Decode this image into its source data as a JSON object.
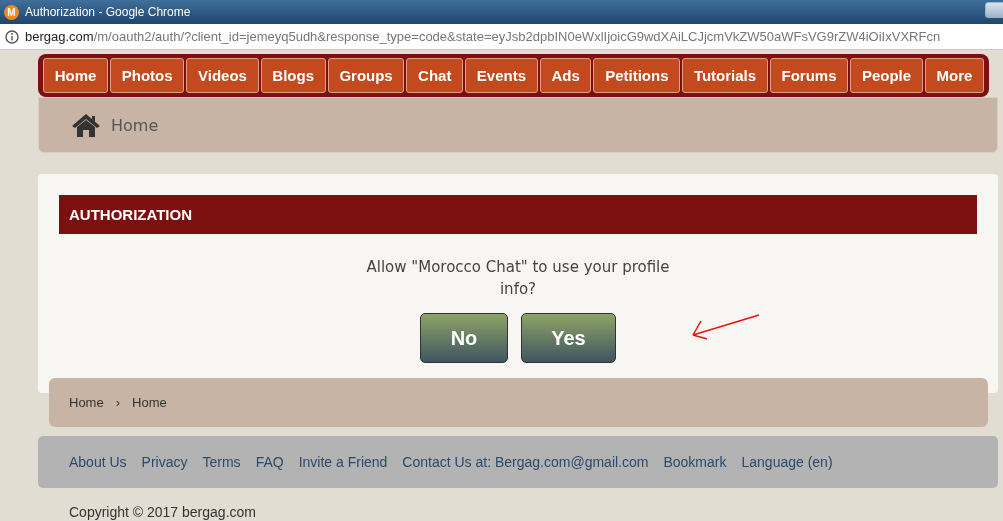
{
  "window": {
    "logo_letter": "M",
    "title": "Authorization - Google Chrome"
  },
  "address_bar": {
    "host": "bergag.com",
    "path": "/m/oauth2/auth/?client_id=jemeyq5udh&response_type=code&state=eyJsb2dpbIN0eWxlIjoicG9wdXAiLCJjcmVkZW50aWFsVG9rZW4iOiIxVXRFcn"
  },
  "nav": [
    "Home",
    "Photos",
    "Videos",
    "Blogs",
    "Groups",
    "Chat",
    "Events",
    "Ads",
    "Petitions",
    "Tutorials",
    "Forums",
    "People",
    "More"
  ],
  "breadcrumb_top": "Home",
  "dialog": {
    "title": "AUTHORIZATION",
    "message": "Allow \"Morocco Chat\" to use your profile info?",
    "buttons": [
      "No",
      "Yes"
    ]
  },
  "breadcrumb_bottom": [
    {
      "label": "Home"
    },
    {
      "label": "Home"
    }
  ],
  "breadcrumb_separator": "›",
  "footer_links": [
    "About Us",
    "Privacy",
    "Terms",
    "FAQ",
    "Invite a Friend",
    "Contact Us at: Bergag.com@gmail.com",
    "Bookmark",
    "Language (en)"
  ],
  "copyright": "Copyright © 2017 bergag.com"
}
